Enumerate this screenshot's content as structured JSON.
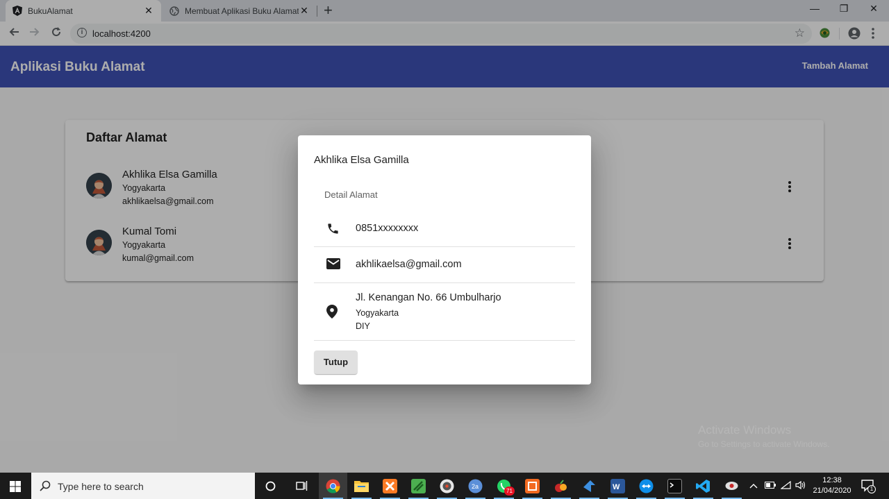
{
  "browser": {
    "tabs": [
      {
        "title": "BukuAlamat",
        "icon": "angular-icon",
        "close": "✕"
      },
      {
        "title": "Membuat Aplikasi Buku Alamat M",
        "icon": "globe-icon",
        "close": "✕"
      }
    ],
    "new_tab": "+",
    "window_controls": {
      "minimize": "—",
      "maximize": "❐",
      "close": "✕"
    },
    "url": "localhost:4200",
    "info_icon": "i",
    "star": "☆"
  },
  "app": {
    "title": "Aplikasi Buku Alamat",
    "add_button": "Tambah Alamat",
    "colors": {
      "primary": "#3f51b5"
    },
    "list": {
      "title": "Daftar Alamat",
      "contacts": [
        {
          "name": "Akhlika Elsa Gamilla",
          "city": "Yogyakarta",
          "email": "akhlikaelsa@gmail.com"
        },
        {
          "name": "Kumal Tomi",
          "city": "Yogyakarta",
          "email": "kumal@gmail.com"
        }
      ]
    }
  },
  "dialog": {
    "title": "Akhlika Elsa Gamilla",
    "subheader": "Detail Alamat",
    "phone": "0851xxxxxxxx",
    "email": "akhlikaelsa@gmail.com",
    "address": {
      "street": "Jl. Kenangan No. 66 Umbulharjo",
      "city": "Yogyakarta",
      "province": "DIY"
    },
    "close_button": "Tutup"
  },
  "watermark": {
    "line1": "Activate Windows",
    "line2": "Go to Settings to activate Windows."
  },
  "taskbar": {
    "search_placeholder": "Type here to search",
    "whatsapp_badge": "71",
    "time": "12:38",
    "date": "21/04/2020",
    "notification_badge": "1"
  }
}
